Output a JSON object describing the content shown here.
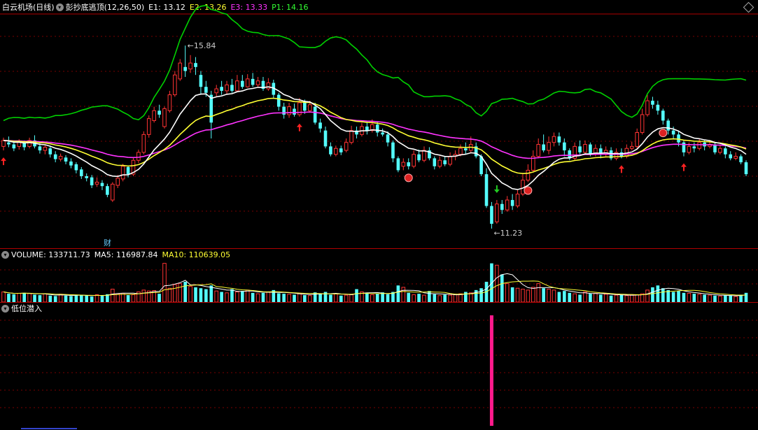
{
  "main_panel": {
    "title": "白云机场(日线)",
    "indicator_name": "彭抄底逃顶(12,26,50)",
    "readouts": [
      {
        "label": "E1: 13.12",
        "color": "#ffffff"
      },
      {
        "label": "E2: 13.26",
        "color": "#ffff33"
      },
      {
        "label": "E3: 13.33",
        "color": "#ff33ff"
      },
      {
        "label": "P1: 14.16",
        "color": "#33ff33"
      }
    ],
    "high_label": "15.84",
    "low_label": "11.23",
    "event_label": "财"
  },
  "volume_panel": {
    "volume_label": "VOLUME: 133711.73",
    "ma5_label": "MA5: 116987.84",
    "ma10_label": "MA10: 110639.05"
  },
  "signal_panel": {
    "title": "低位潜入"
  },
  "colors": {
    "up": "#ff3333",
    "down": "#54ffff",
    "e1": "#ffffff",
    "e2": "#ffff33",
    "e3": "#ff33ff",
    "p1": "#00d000",
    "grid": "#7a0000",
    "signal": "#ff1a8c"
  },
  "icons": [
    "chevron-down-icon",
    "diamond-icon"
  ],
  "chart_data": {
    "type": "candlestick",
    "price_range": [
      11.0,
      16.6
    ],
    "candles": [
      [
        13.3,
        13.45,
        13.52,
        13.2
      ],
      [
        13.4,
        13.35,
        13.55,
        13.28
      ],
      [
        13.35,
        13.25,
        13.42,
        13.18
      ],
      [
        13.3,
        13.4,
        13.48,
        13.22
      ],
      [
        13.38,
        13.28,
        13.45,
        13.2
      ],
      [
        13.3,
        13.45,
        13.52,
        13.25
      ],
      [
        13.45,
        13.3,
        13.58,
        13.25
      ],
      [
        13.3,
        13.2,
        13.38,
        13.12
      ],
      [
        13.2,
        13.28,
        13.35,
        13.1
      ],
      [
        13.25,
        13.1,
        13.32,
        13.02
      ],
      [
        13.1,
        12.98,
        13.18,
        12.9
      ],
      [
        12.98,
        13.05,
        13.12,
        12.92
      ],
      [
        13.02,
        12.92,
        13.08,
        12.85
      ],
      [
        12.92,
        12.82,
        13.0,
        12.75
      ],
      [
        12.85,
        12.7,
        12.9,
        12.62
      ],
      [
        12.72,
        12.55,
        12.78,
        12.48
      ],
      [
        12.55,
        12.5,
        12.62,
        12.42
      ],
      [
        12.52,
        12.32,
        12.58,
        12.25
      ],
      [
        12.35,
        12.4,
        12.52,
        12.28
      ],
      [
        12.38,
        12.3,
        12.45,
        12.2
      ],
      [
        12.3,
        12.08,
        12.36,
        12.02
      ],
      [
        11.95,
        12.35,
        12.4,
        11.9
      ],
      [
        12.32,
        12.5,
        12.58,
        12.25
      ],
      [
        12.48,
        12.8,
        12.86,
        12.42
      ],
      [
        12.78,
        12.6,
        12.82,
        12.52
      ],
      [
        12.6,
        12.95,
        13.02,
        12.55
      ],
      [
        12.95,
        13.15,
        13.22,
        12.88
      ],
      [
        13.15,
        13.6,
        13.68,
        13.1
      ],
      [
        13.6,
        14.0,
        14.08,
        13.52
      ],
      [
        13.95,
        14.2,
        14.3,
        13.9
      ],
      [
        14.2,
        14.1,
        14.35,
        14.02
      ],
      [
        13.8,
        14.25,
        14.3,
        13.75
      ],
      [
        14.2,
        14.6,
        14.7,
        14.15
      ],
      [
        14.6,
        15.1,
        15.2,
        14.55
      ],
      [
        15.0,
        15.4,
        15.5,
        14.95
      ],
      [
        15.3,
        15.2,
        15.84,
        15.05
      ],
      [
        15.25,
        15.4,
        15.6,
        15.15
      ],
      [
        15.4,
        15.3,
        15.55,
        15.1
      ],
      [
        15.1,
        14.8,
        15.2,
        14.6
      ],
      [
        14.8,
        14.65,
        14.95,
        14.55
      ],
      [
        14.6,
        13.9,
        14.7,
        13.5
      ],
      [
        14.65,
        14.75,
        14.85,
        14.55
      ],
      [
        14.8,
        14.7,
        14.95,
        14.6
      ],
      [
        14.7,
        14.85,
        14.95,
        14.62
      ],
      [
        14.85,
        14.7,
        15.0,
        14.65
      ],
      [
        14.7,
        14.95,
        15.1,
        14.68
      ],
      [
        14.95,
        14.8,
        15.1,
        14.75
      ],
      [
        14.8,
        15.0,
        15.12,
        14.78
      ],
      [
        15.0,
        14.85,
        15.15,
        14.8
      ],
      [
        14.85,
        14.95,
        15.05,
        14.78
      ],
      [
        14.95,
        14.75,
        15.05,
        14.7
      ],
      [
        14.75,
        14.9,
        15.02,
        14.7
      ],
      [
        14.9,
        14.6,
        14.98,
        14.5
      ],
      [
        14.6,
        14.3,
        14.65,
        14.2
      ],
      [
        14.3,
        14.1,
        14.4,
        14.0
      ],
      [
        14.1,
        14.3,
        14.4,
        14.02
      ],
      [
        14.25,
        14.1,
        14.38,
        14.05
      ],
      [
        14.1,
        14.4,
        14.52,
        14.05
      ],
      [
        14.4,
        14.2,
        14.48,
        14.12
      ],
      [
        14.2,
        14.35,
        14.45,
        14.15
      ],
      [
        14.3,
        13.9,
        14.4,
        13.85
      ],
      [
        13.9,
        13.75,
        14.0,
        13.65
      ],
      [
        13.7,
        13.3,
        13.8,
        13.25
      ],
      [
        13.3,
        13.1,
        13.4,
        13.05
      ],
      [
        13.1,
        13.25,
        13.32,
        13.05
      ],
      [
        13.25,
        13.15,
        13.32,
        13.08
      ],
      [
        13.2,
        13.4,
        13.5,
        13.15
      ],
      [
        13.4,
        13.7,
        13.82,
        13.35
      ],
      [
        13.7,
        13.6,
        13.8,
        13.5
      ],
      [
        13.6,
        13.8,
        13.9,
        13.55
      ],
      [
        13.8,
        13.7,
        13.92,
        13.6
      ],
      [
        13.7,
        13.85,
        13.98,
        13.65
      ],
      [
        13.85,
        13.65,
        13.92,
        13.55
      ],
      [
        13.65,
        13.6,
        13.75,
        13.55
      ],
      [
        13.6,
        13.4,
        13.68,
        13.3
      ],
      [
        13.4,
        13.0,
        13.45,
        12.9
      ],
      [
        13.0,
        12.7,
        13.05,
        12.65
      ],
      [
        12.8,
        12.9,
        13.0,
        12.7
      ],
      [
        12.9,
        12.8,
        13.0,
        12.72
      ],
      [
        12.8,
        13.1,
        13.2,
        12.75
      ],
      [
        13.1,
        12.95,
        13.22,
        12.9
      ],
      [
        12.95,
        13.2,
        13.3,
        12.9
      ],
      [
        13.2,
        13.0,
        13.28,
        12.95
      ],
      [
        13.0,
        12.8,
        13.05,
        12.72
      ],
      [
        12.8,
        12.95,
        13.05,
        12.75
      ],
      [
        12.95,
        12.85,
        13.05,
        12.8
      ],
      [
        12.85,
        13.05,
        13.15,
        12.8
      ],
      [
        13.05,
        13.1,
        13.2,
        12.95
      ],
      [
        13.1,
        13.25,
        13.35,
        13.05
      ],
      [
        13.25,
        13.2,
        13.4,
        13.1
      ],
      [
        13.2,
        13.35,
        13.55,
        13.15
      ],
      [
        13.3,
        13.05,
        13.4,
        13.0
      ],
      [
        13.05,
        12.6,
        13.1,
        12.55
      ],
      [
        12.6,
        11.8,
        12.75,
        11.75
      ],
      [
        11.8,
        11.35,
        11.9,
        11.23
      ],
      [
        11.4,
        11.85,
        11.95,
        11.35
      ],
      [
        11.85,
        11.7,
        11.95,
        11.6
      ],
      [
        11.7,
        11.95,
        12.05,
        11.65
      ],
      [
        11.95,
        11.8,
        12.1,
        11.7
      ],
      [
        11.8,
        12.1,
        12.2,
        11.75
      ],
      [
        12.1,
        12.45,
        12.6,
        12.05
      ],
      [
        12.45,
        12.7,
        12.85,
        12.4
      ],
      [
        12.7,
        13.05,
        13.2,
        12.65
      ],
      [
        13.05,
        13.35,
        13.5,
        13.0
      ],
      [
        13.35,
        13.2,
        13.6,
        13.15
      ],
      [
        13.2,
        13.4,
        13.55,
        13.1
      ],
      [
        13.4,
        13.55,
        13.65,
        13.3
      ],
      [
        13.55,
        13.4,
        13.65,
        13.32
      ],
      [
        13.4,
        13.2,
        13.5,
        13.05
      ],
      [
        13.2,
        13.0,
        13.25,
        12.95
      ],
      [
        13.0,
        13.3,
        13.4,
        12.95
      ],
      [
        13.3,
        13.15,
        13.45,
        13.1
      ],
      [
        13.15,
        13.35,
        13.45,
        13.1
      ],
      [
        13.35,
        13.1,
        13.4,
        13.05
      ],
      [
        13.1,
        13.25,
        13.35,
        13.05
      ],
      [
        13.25,
        13.1,
        13.35,
        13.0
      ],
      [
        13.1,
        13.2,
        13.3,
        13.05
      ],
      [
        13.2,
        13.0,
        13.28,
        12.95
      ],
      [
        13.0,
        13.15,
        13.25,
        12.95
      ],
      [
        13.15,
        13.05,
        13.25,
        13.0
      ],
      [
        13.05,
        13.25,
        13.35,
        13.0
      ],
      [
        13.25,
        13.3,
        13.42,
        13.2
      ],
      [
        13.3,
        13.65,
        13.75,
        13.25
      ],
      [
        13.65,
        14.1,
        14.25,
        13.6
      ],
      [
        14.1,
        14.45,
        14.6,
        14.05
      ],
      [
        14.45,
        14.35,
        14.55,
        14.25
      ],
      [
        14.35,
        14.2,
        14.45,
        14.1
      ],
      [
        14.2,
        13.95,
        14.25,
        13.85
      ],
      [
        13.95,
        13.7,
        14.0,
        13.6
      ],
      [
        13.7,
        13.6,
        13.8,
        13.5
      ],
      [
        13.6,
        13.4,
        13.7,
        13.3
      ],
      [
        13.4,
        13.15,
        13.45,
        13.05
      ],
      [
        13.15,
        13.3,
        13.4,
        13.1
      ],
      [
        13.3,
        13.25,
        13.4,
        13.15
      ],
      [
        13.25,
        13.4,
        13.5,
        13.2
      ],
      [
        13.4,
        13.3,
        13.45,
        13.2
      ],
      [
        13.3,
        13.35,
        13.45,
        13.25
      ],
      [
        13.35,
        13.15,
        13.4,
        13.1
      ],
      [
        13.15,
        13.25,
        13.35,
        13.1
      ],
      [
        13.25,
        13.1,
        13.3,
        13.0
      ],
      [
        13.1,
        13.0,
        13.18,
        12.95
      ],
      [
        13.0,
        13.05,
        13.15,
        12.95
      ],
      [
        13.05,
        12.9,
        13.1,
        12.85
      ],
      [
        12.9,
        12.6,
        12.95,
        12.55
      ]
    ],
    "volume_range": [
      0,
      440000
    ],
    "volumes": [
      110000,
      90000,
      85000,
      95000,
      100000,
      95000,
      80000,
      75000,
      90000,
      70000,
      65000,
      85000,
      70000,
      65000,
      80000,
      75000,
      70000,
      60000,
      80000,
      70000,
      85000,
      140000,
      90000,
      95000,
      75000,
      80000,
      110000,
      130000,
      120000,
      125000,
      90000,
      420000,
      150000,
      190000,
      200000,
      220000,
      170000,
      160000,
      150000,
      140000,
      180000,
      120000,
      110000,
      100000,
      140000,
      110000,
      120000,
      130000,
      100000,
      90000,
      100000,
      110000,
      130000,
      95000,
      90000,
      85000,
      80000,
      95000,
      75000,
      70000,
      105000,
      90000,
      110000,
      80000,
      90000,
      70000,
      75000,
      80000,
      140000,
      110000,
      95000,
      80000,
      90000,
      105000,
      85000,
      110000,
      180000,
      160000,
      100000,
      80000,
      90000,
      75000,
      120000,
      85000,
      70000,
      80000,
      75000,
      85000,
      90000,
      110000,
      100000,
      130000,
      150000,
      220000,
      420000,
      400000,
      300000,
      200000,
      160000,
      150000,
      140000,
      130000,
      160000,
      200000,
      150000,
      140000,
      130000,
      110000,
      120000,
      100000,
      90000,
      80000,
      110000,
      90000,
      95000,
      80000,
      85000,
      70000,
      75000,
      80000,
      70000,
      75000,
      80000,
      90000,
      130000,
      160000,
      180000,
      150000,
      130000,
      110000,
      120000,
      100000,
      95000,
      90000,
      85000,
      80000,
      75000,
      70000,
      65000,
      75000,
      70000,
      60000,
      80000,
      100000
    ],
    "signals": [
      {
        "index": 94,
        "value": 1
      }
    ]
  }
}
